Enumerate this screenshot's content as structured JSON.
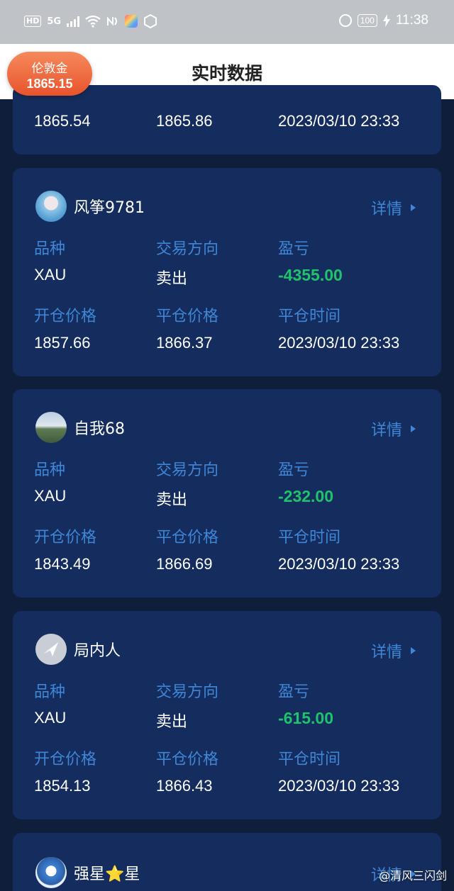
{
  "status_bar": {
    "hd": "HD",
    "network": "5G",
    "battery": "100",
    "time": "11:38"
  },
  "header": {
    "title": "实时数据",
    "badge_name": "伦敦金",
    "badge_price": "1865.15"
  },
  "labels": {
    "variety": "品种",
    "direction": "交易方向",
    "pnl": "盈亏",
    "open_price": "开仓价格",
    "close_price": "平仓价格",
    "close_time": "平仓时间",
    "detail": "详情"
  },
  "partial_card": {
    "open_price": "1865.54",
    "close_price": "1865.86",
    "close_time": "2023/03/10 23:33"
  },
  "cards": [
    {
      "user": "风筝9781",
      "variety": "XAU",
      "direction": "卖出",
      "pnl": "-4355.00",
      "open_price": "1857.66",
      "close_price": "1866.37",
      "close_time": "2023/03/10 23:33"
    },
    {
      "user": "自我68",
      "variety": "XAU",
      "direction": "卖出",
      "pnl": "-232.00",
      "open_price": "1843.49",
      "close_price": "1866.69",
      "close_time": "2023/03/10 23:33"
    },
    {
      "user": "局内人",
      "variety": "XAU",
      "direction": "卖出",
      "pnl": "-615.00",
      "open_price": "1854.13",
      "close_price": "1866.43",
      "close_time": "2023/03/10 23:33"
    }
  ],
  "last_card": {
    "user": "强星⭐星",
    "detail": "详情"
  },
  "watermark": "@清风三闪剑",
  "colors": {
    "background": "#0f1e3a",
    "card": "#142c5e",
    "label": "#3f87d6",
    "pnl_green": "#1fc36b",
    "badge": "#ec6034"
  }
}
